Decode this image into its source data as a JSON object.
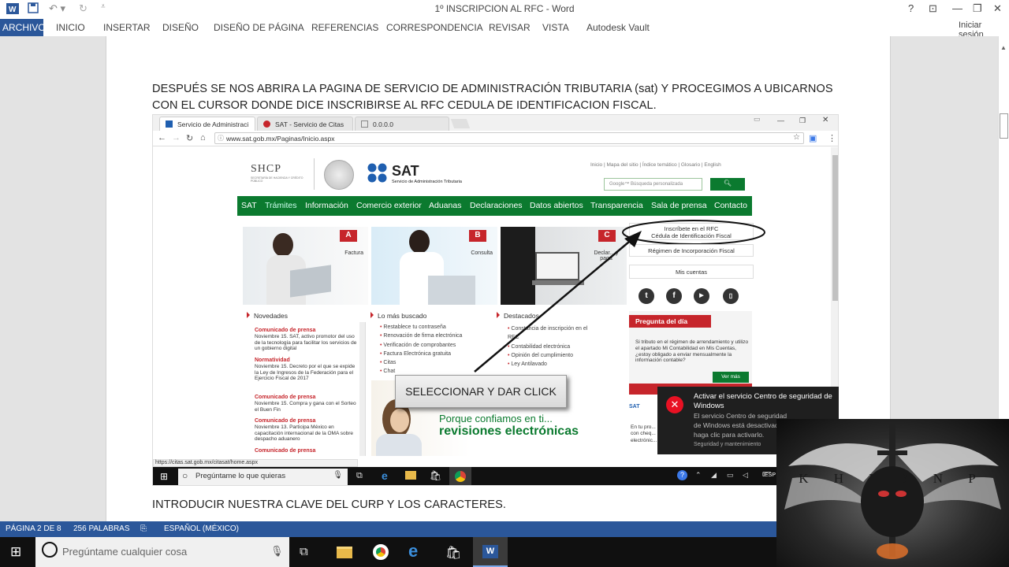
{
  "word": {
    "title": "1º INSCRIPCION AL RFC - Word",
    "sign_in": "Iniciar sesión",
    "help": "?",
    "tabs": [
      "ARCHIVO",
      "INICIO",
      "INSERTAR",
      "DISEÑO",
      "DISEÑO DE PÁGINA",
      "REFERENCIAS",
      "CORRESPONDENCIA",
      "REVISAR",
      "VISTA",
      "Autodesk Vault"
    ],
    "accent": "#2b579a"
  },
  "document": {
    "paragraph_line1": "DESPUÉS SE NOS ABRIRA LA PAGINA DE SERVICIO DE ADMINISTRACIÓN TRIBUTARIA (sat) Y PROCEGIMOS A UBICARNOS",
    "paragraph_line2": "CON EL CURSOR DONDE DICE INSCRIBIRSE AL RFC CEDULA DE IDENTIFICACION FISCAL.",
    "paragraph_bottom": "INTRODUCIR NUESTRA CLAVE DEL CURP Y LOS CARACTERES."
  },
  "browser": {
    "tabs": [
      "Servicio de Administraci",
      "SAT - Servicio de Citas",
      "0.0.0.0"
    ],
    "url": "www.sat.gob.mx/Paginas/Inicio.aspx",
    "status_url": "https://citas.sat.gob.mx/citasat/home.aspx"
  },
  "site": {
    "shcp": "SHCP",
    "shcp_sub": "SECRETARÍA DE HACIENDA Y CRÉDITO PÚBLICO",
    "sat": "SAT",
    "sat_sub": "Servicio de Administración Tributaria",
    "top_links": "Inicio | Mapa del sitio | Índice temático | Glosario | English",
    "search_placeholder": "Google™ Búsqueda personalizada",
    "nav": [
      "SAT",
      "Trámites",
      "Información",
      "Comercio exterior",
      "Aduanas",
      "Declaraciones",
      "Datos abiertos",
      "Transparencia",
      "Sala de prensa",
      "Contacto"
    ],
    "tiles": [
      {
        "badge": "A",
        "label": "Factura"
      },
      {
        "badge": "B",
        "label": "Consulta"
      },
      {
        "badge": "C",
        "label": "Declar... y paga"
      }
    ],
    "side_rfc_1": "Inscríbete en el RFC",
    "side_rfc_2": "Cédula de Identificación Fiscal",
    "side_rif": "Régimen de Incorporación Fiscal",
    "side_mis": "Mis cuentas",
    "col_novedades": "Novedades",
    "col_buscado": "Lo más buscado",
    "col_destacados": "Destacados",
    "news": [
      {
        "tag": "Comunicado de prensa",
        "text": "Noviembre 15. SAT, activo promotor del uso de la tecnología para facilitar los servicios de un gobierno digital"
      },
      {
        "tag": "Normatividad",
        "text": "Noviembre 15. Decreto por el que se expide la Ley de Ingresos de la Federación para el Ejercicio Fiscal de 2017"
      },
      {
        "tag": "Comunicado de prensa",
        "text": "Noviembre 15. Compra y gana con el Sorteo el Buen Fin"
      },
      {
        "tag": "Comunicado de prensa",
        "text": "Noviembre 13. Participa México en capacitación internacional de la OMA sobre despacho aduanero"
      },
      {
        "tag": "Comunicado de prensa",
        "text": ""
      }
    ],
    "buscado": [
      "Restablece tu contraseña",
      "Renovación de firma electrónica",
      "Verificación de comprobantes",
      "Factura Electrónica gratuita",
      "Citas",
      "Chat"
    ],
    "destacados": [
      "Constancia de inscripción en el RFC",
      "Contabilidad electrónica",
      "Opinión del cumplimiento",
      "Ley Antilavado"
    ],
    "pregunta_title": "Pregunta del día",
    "pregunta_text": "Si tributo en el régimen de arrendamiento y utilizo el apartado Mi Contabilidad en Mis Cuentas, ¿estoy obligado a enviar mensualmente la información contable?",
    "ver_mas": "Ver más",
    "banner_1": "Porque confiamos en ti...",
    "banner_2": "revisiones electrónicas",
    "side_bottom": "En tu pro... con cheq... electrónic...",
    "callout": "SELECCIONAR Y DAR CLICK",
    "green": "#0b7a2f",
    "red": "#c6252b"
  },
  "inner_taskbar": {
    "search": "Pregúntame lo que quieras",
    "lang": "ESP"
  },
  "notification": {
    "title": "Activar el servicio Centro de seguridad de Windows",
    "body": "El servicio Centro de seguridad de Windows está desactivad haga clic para activarlo.",
    "footer": "Seguridad y mantenimiento"
  },
  "statusbar": {
    "page": "PÁGINA 2 DE 8",
    "words": "256 PALABRAS",
    "lang": "ESPAÑOL (MÉXICO)"
  },
  "taskbar": {
    "search": "Pregúntame cualquier cosa"
  },
  "logo": {
    "letters": "K H I B N P"
  }
}
